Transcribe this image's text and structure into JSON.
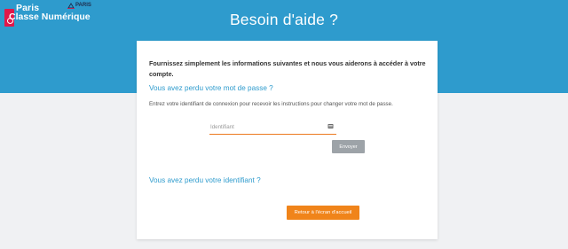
{
  "brand": {
    "line1": "Paris",
    "line2": "Classe Numérique",
    "city": "PARIS"
  },
  "header": {
    "title": "Besoin d'aide ?"
  },
  "card": {
    "intro": "Fournissez simplement les informations suivantes et nous vous aiderons à accéder à votre compte.",
    "password_section": {
      "title": "Vous avez perdu votre mot de passe ?",
      "instructions": "Entrez votre identifiant de connexion pour recevoir les instructions pour changer votre mot de passe.",
      "identifier_placeholder": "Identifiant",
      "identifier_value": "",
      "send_label": "Envoyer"
    },
    "identifier_section": {
      "title": "Vous avez perdu votre identifiant ?"
    },
    "home_label": "Retour à l'écran d'accueil"
  },
  "colors": {
    "header_bg": "#2e9bcd",
    "accent_link": "#2e9bcd",
    "primary_button": "#f0841a",
    "disabled_button": "#9da3a8",
    "input_underline": "#ec7a1f",
    "logo_badge": "#e0184a"
  },
  "icons": {
    "field": "id-card-icon",
    "city": "paris-city-icon"
  }
}
